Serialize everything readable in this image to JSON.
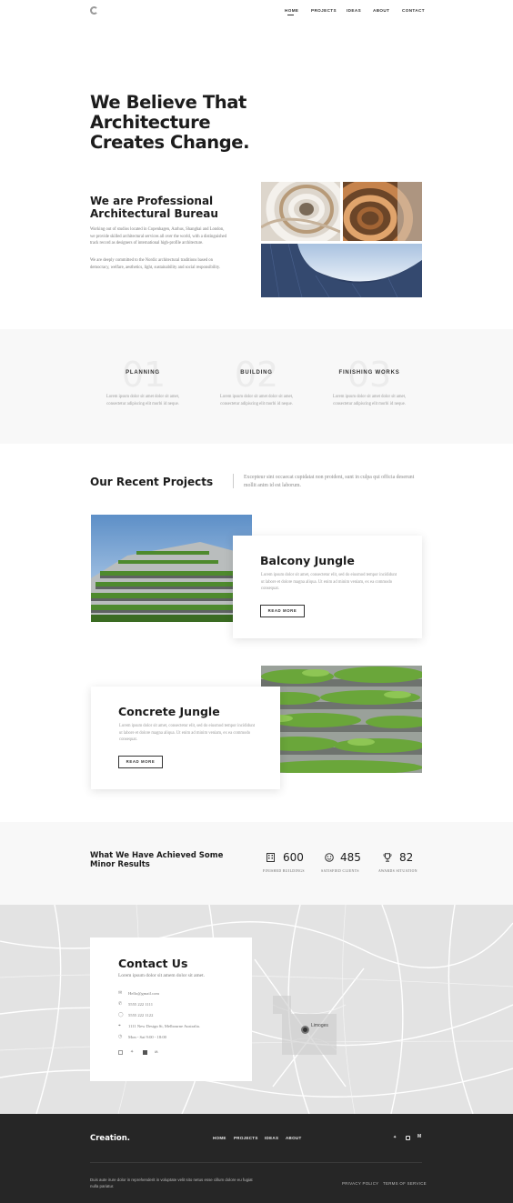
{
  "header": {
    "nav": [
      {
        "label": "HOME"
      },
      {
        "label": "PROJECTS"
      },
      {
        "label": "IDEAS"
      },
      {
        "label": "ABOUT"
      },
      {
        "label": "CONTACT"
      }
    ]
  },
  "hero": {
    "line1": "We Believe That Architecture",
    "line2": "Creates Change."
  },
  "about": {
    "title_line1": "We are Professional",
    "title_line2": "Architectural Bureau",
    "p1": "Working out of studios located in Copenhagen, Aarhus, Shanghai and London, we provide skilled architectural services all over the world, with a distinguished track record as designers of international high-profile architecture.",
    "p2": "We are deeply committed to the Nordic architectural traditions based on democracy, welfare, aesthetics, light, sustainability and social responsibility."
  },
  "services": [
    {
      "num": "01",
      "title": "PLANNING",
      "desc": "Lorem ipsum dolor sit amet dolor sit amet, consectetur adipiscing elit morbi id neque."
    },
    {
      "num": "02",
      "title": "BUILDING",
      "desc": "Lorem ipsum dolor sit amet dolor sit amet, consectetur adipiscing elit morbi id neque."
    },
    {
      "num": "03",
      "title": "FINISHING WORKS",
      "desc": "Lorem ipsum dolor sit amet dolor sit amet, consectetur adipiscing elit morbi id neque."
    }
  ],
  "projects": {
    "title": "Our Recent Projects",
    "intro": "Excepteur sint occaecat cupidatat non proident, sunt in culpa qui officia deserunt mollit anim id est laborum.",
    "items": [
      {
        "title": "Balcony Jungle",
        "desc": "Lorem ipsum dolor sit amet, consectetur elit, sed do eiusmod tempor incididunt ut labore et dolore magna aliqua. Ut enim ad minim veniam, ex ea commodo consequat.",
        "button": "READ MORE"
      },
      {
        "title": "Concrete Jungle",
        "desc": "Lorem ipsum dolor sit amet, consectetur elit, sed do eiusmod tempor incididunt ut labore et dolore magna aliqua. Ut enim ad minim veniam, ex ea commodo consequat.",
        "button": "READ MORE"
      }
    ]
  },
  "results": {
    "title_line1": "What We Have Achieved Some",
    "title_line2": "Minor Results",
    "stats": [
      {
        "icon": "building-icon",
        "value": "600",
        "label": "FINISHED BUILDINGS"
      },
      {
        "icon": "smile-icon",
        "value": "485",
        "label": "SATISFIED CLIENTS"
      },
      {
        "icon": "trophy-icon",
        "value": "82",
        "label": "AWARDS SITUATION"
      }
    ]
  },
  "contact": {
    "title": "Contact Us",
    "subtitle": "Lorem ipsum dolor sit amem dolor sit amet.",
    "lines": [
      {
        "icon": "email-icon",
        "text": "Hello@gmail.com"
      },
      {
        "icon": "phone-icon",
        "text": "5555 222 1111"
      },
      {
        "icon": "whatsapp-icon",
        "text": "5555 222 1122"
      },
      {
        "icon": "location-icon",
        "text": "1111 New Design St, Melbourne Australia."
      },
      {
        "icon": "clock-icon",
        "text": "Mon - Sat 9:00 - 18:00"
      }
    ],
    "map_pin_label": "Limoges"
  },
  "footer": {
    "brand": "Creation.",
    "nav": [
      {
        "label": "HOME"
      },
      {
        "label": "PROJECTS"
      },
      {
        "label": "IDEAS"
      },
      {
        "label": "ABOUT"
      }
    ],
    "copy": "Duis aute irure dolor in reprehenderit in voluptate velit sito netus esse cillum dolore eu fugiat nulla pariatur.",
    "privacy": "PRIVACY POLICY",
    "terms": "TERMS OF SERVICE"
  }
}
